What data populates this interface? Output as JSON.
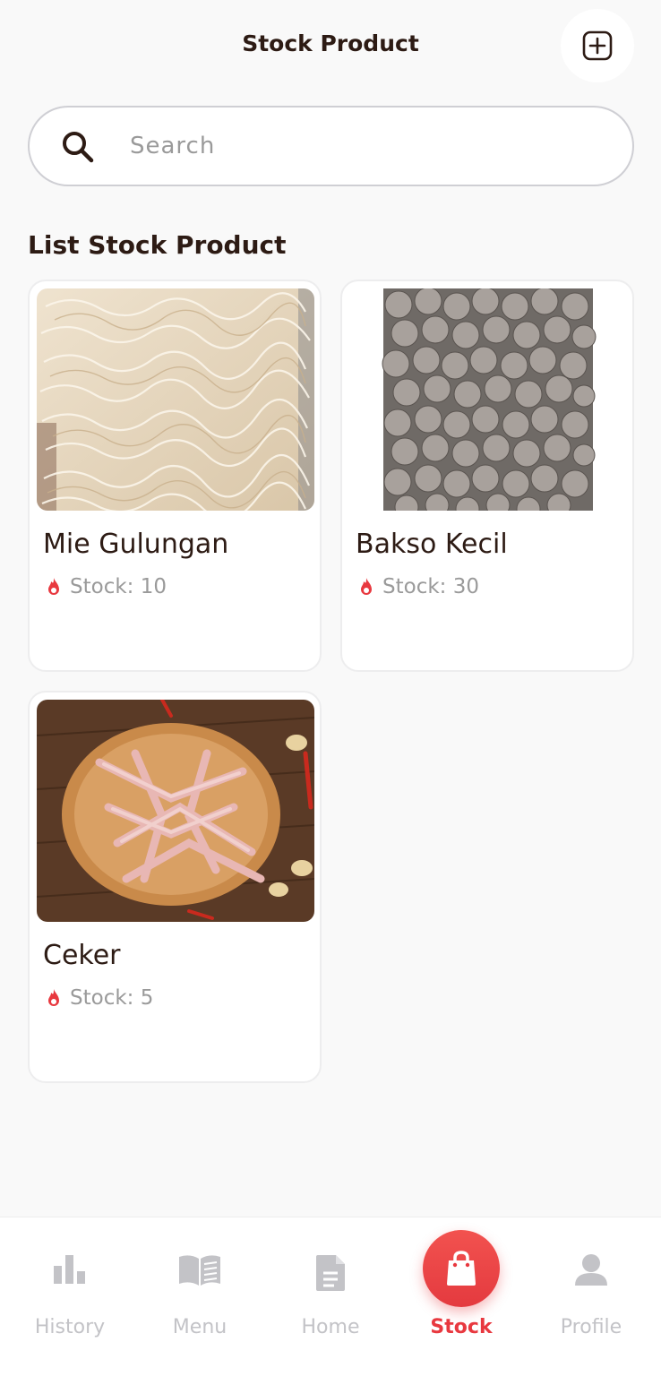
{
  "header": {
    "title": "Stock Product",
    "add_icon": "plus-square-icon"
  },
  "search": {
    "placeholder": "Search",
    "value": "",
    "icon": "search-icon"
  },
  "section": {
    "title": "List Stock Product"
  },
  "products": [
    {
      "name": "Mie Gulungan",
      "stock": "Stock: 10",
      "image": "rolled-noodles-photo"
    },
    {
      "name": "Bakso Kecil",
      "stock": "Stock: 30",
      "image": "meatballs-photo"
    },
    {
      "name": "Ceker",
      "stock": "Stock: 5",
      "image": "chicken-feet-photo"
    }
  ],
  "nav": {
    "items": [
      {
        "label": "History",
        "icon": "bar-chart-icon",
        "active": false
      },
      {
        "label": "Menu",
        "icon": "book-icon",
        "active": false
      },
      {
        "label": "Home",
        "icon": "document-icon",
        "active": false
      },
      {
        "label": "Stock",
        "icon": "shopping-bag-icon",
        "active": true
      },
      {
        "label": "Profile",
        "icon": "person-icon",
        "active": false
      }
    ]
  },
  "colors": {
    "accent": "#e8383f",
    "text": "#2d1b14",
    "muted": "#9a9a9a",
    "inactive_nav": "#c3c3c7",
    "background": "#f9f9f9"
  }
}
